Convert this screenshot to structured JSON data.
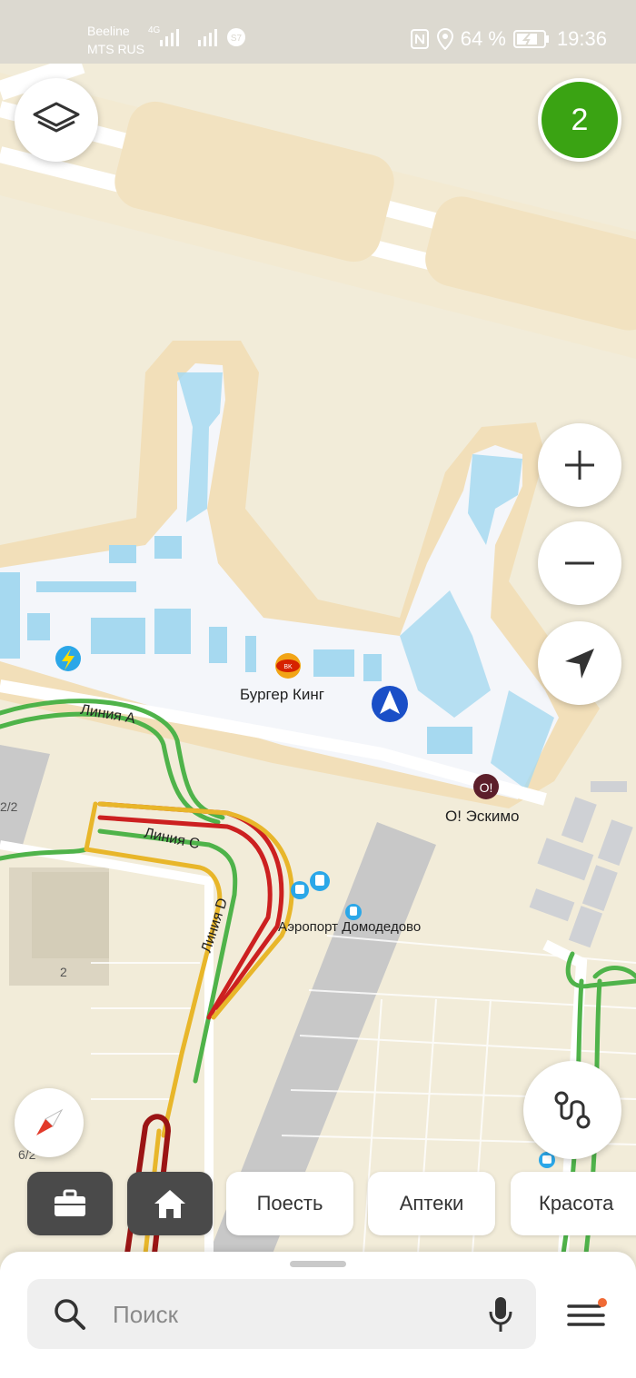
{
  "status_bar": {
    "carrier_1": "Beeline",
    "carrier_2": "MTS RUS",
    "network": "4G",
    "battery": "64 %",
    "time": "19:36",
    "icons": [
      "signal-icon",
      "signal-icon",
      "s7-app-icon",
      "nfc-icon",
      "location-icon",
      "battery-charging-icon"
    ]
  },
  "map": {
    "labels": {
      "burger_king": "Бургер Кинг",
      "eskimo": "О! Эскимо",
      "airport_stop": "Аэропорт Домодедово",
      "line_a": "Линия А",
      "line_c": "Линия С",
      "line_d": "Линия D",
      "building_2": "2",
      "house_2_2": "2/2",
      "house_6_2": "6/2"
    },
    "colors": {
      "ground": "#f2ecd9",
      "sand": "#f2dfb9",
      "terminal": "#f4f6fa",
      "water": "#a6d9f0",
      "road": "#ffffff",
      "traffic_green": "#4fb34a",
      "traffic_yellow": "#e8b62a",
      "traffic_red": "#cc2020",
      "traffic_darkred": "#9b1414"
    }
  },
  "controls": {
    "traffic_level": "2",
    "layers_icon": "layers-icon",
    "zoom_in_icon": "plus-icon",
    "zoom_out_icon": "minus-icon",
    "locate_icon": "navigation-arrow-icon",
    "compass_icon": "compass-icon",
    "route_icon": "route-icon"
  },
  "chips": {
    "work_icon": "briefcase-icon",
    "home_icon": "home-icon",
    "eat": "Поесть",
    "pharmacy": "Аптеки",
    "beauty": "Красота"
  },
  "search": {
    "placeholder": "Поиск",
    "search_icon": "search-icon",
    "mic_icon": "microphone-icon",
    "menu_icon": "menu-icon"
  }
}
